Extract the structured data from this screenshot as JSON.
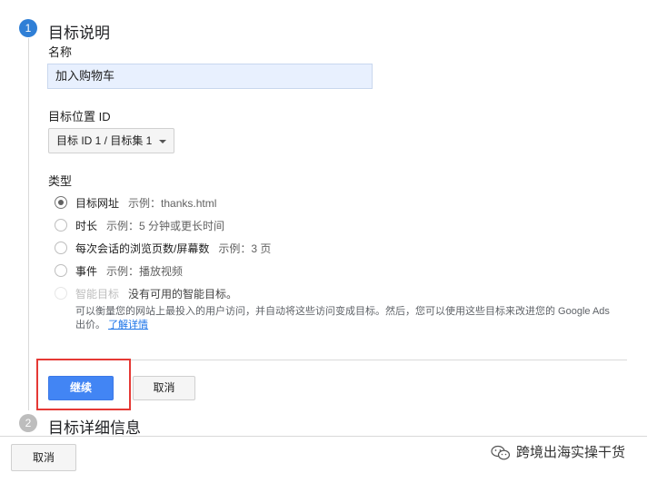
{
  "steps": {
    "step1": {
      "number": "1",
      "title": "目标说明"
    },
    "step2": {
      "number": "2",
      "title": "目标详细信息"
    }
  },
  "name_field": {
    "label": "名称",
    "value": "加入购物车"
  },
  "goal_slot": {
    "label": "目标位置 ID",
    "selected": "目标 ID 1 / 目标集 1"
  },
  "type": {
    "label": "类型",
    "options": [
      {
        "label": "目标网址",
        "example": "示例：thanks.html",
        "checked": true
      },
      {
        "label": "时长",
        "example": "示例：5 分钟或更长时间"
      },
      {
        "label": "每次会话的浏览页数/屏幕数",
        "example": "示例：3 页"
      },
      {
        "label": "事件",
        "example": "示例：播放视频"
      },
      {
        "label": "智能目标",
        "example": "没有可用的智能目标。",
        "disabled": true
      }
    ],
    "smart_desc": "可以衡量您的网站上最投入的用户访问，并自动将这些访问变成目标。然后，您可以使用这些目标来改进您的 Google Ads 出价。",
    "learn_more": "了解详情"
  },
  "buttons": {
    "continue": "继续",
    "cancel": "取消",
    "bottom_cancel": "取消"
  },
  "watermark": "跨境出海实操干货",
  "colors": {
    "primary": "#4285f4",
    "highlight": "#e53935",
    "step_active": "#2f7fd6",
    "step_inactive": "#bdbdbd"
  }
}
